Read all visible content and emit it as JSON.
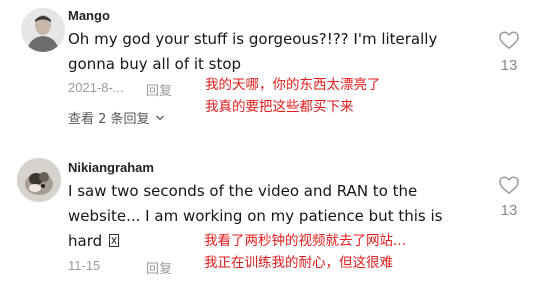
{
  "comments": [
    {
      "username": "Mango",
      "text_lines": [
        "Oh my god your stuff is gorgeous?!?? I'm literally",
        "gonna buy all of it stop"
      ],
      "date": "2021-8-...",
      "reply_label": "回复",
      "translation_lines": [
        "我的天哪，你的东西太漂亮了",
        "我真的要把这些都买下来"
      ],
      "view_replies_label": "查看 2 条回复",
      "like_count": "13",
      "icons": {
        "like": "heart-outline-icon",
        "expand": "chevron-down-icon"
      }
    },
    {
      "username": "Nikiangraham",
      "text_lines": [
        "I saw two seconds of the video and RAN to the",
        "website... I am working on my patience but this is",
        "hard"
      ],
      "date": "11-15",
      "reply_label": "回复",
      "translation_lines": [
        "我看了两秒钟的视频就去了网站...",
        "我正在训练我的耐心，但这很难"
      ],
      "like_count": "13",
      "icons": {
        "like": "heart-outline-icon",
        "emoji": "missing-glyph-icon"
      }
    }
  ],
  "colors": {
    "translation": "#e21c1c",
    "meta": "#9a9a9a",
    "text": "#161616"
  }
}
